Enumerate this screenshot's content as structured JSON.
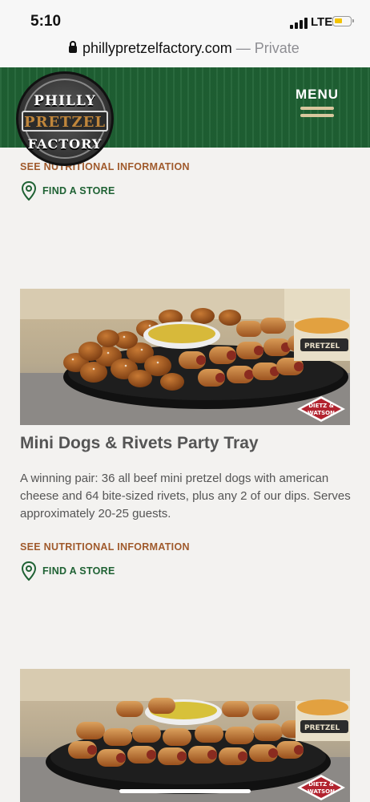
{
  "status": {
    "time": "5:10",
    "network": "LTE"
  },
  "browser": {
    "domain": "phillypretzelfactory.com",
    "private_label": "— Private"
  },
  "header": {
    "logo_lines": [
      "PHILLY",
      "PRETZEL",
      "FACTORY"
    ],
    "menu_label": "MENU"
  },
  "top_links": {
    "nutrition": "SEE NUTRITIONAL INFORMATION",
    "find_store": "FIND A STORE"
  },
  "products": [
    {
      "title": "Mini Dogs & Rivets Party Tray",
      "description": "A winning pair: 36 all beef mini pretzel dogs with american cheese and 64 bite-sized rivets, plus any 2 of our dips. Serves approximately 20-25 guests.",
      "nutrition_label": "SEE NUTRITIONAL INFORMATION",
      "find_store_label": "FIND A STORE",
      "badge_lines": [
        "DIETZ &",
        "WATSON"
      ],
      "cup_label": "PRETZEL"
    },
    {
      "badge_lines": [
        "DIETZ &",
        "WATSON"
      ],
      "cup_label": "PRETZEL"
    }
  ],
  "colors": {
    "brand_green": "#1f6234",
    "link_brown": "#a05a2c",
    "text_gray": "#555555"
  }
}
